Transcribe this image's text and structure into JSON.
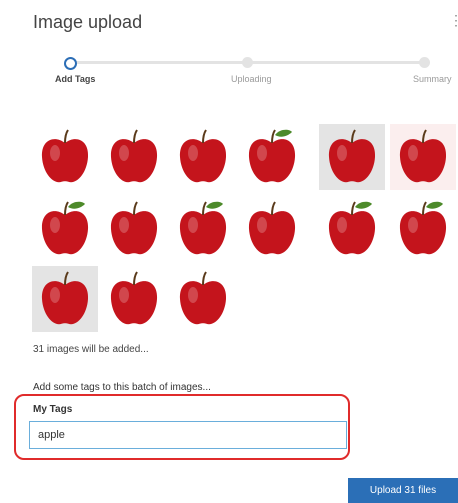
{
  "dialog": {
    "title": "Image upload"
  },
  "stepper": {
    "steps": [
      {
        "label": "Add Tags",
        "state": "active"
      },
      {
        "label": "Uploading",
        "state": "pending"
      },
      {
        "label": "Summary",
        "state": "pending"
      }
    ]
  },
  "images": {
    "count_text": "31 images will be added...",
    "thumbnails": [
      {
        "icon": "red-apple-image",
        "bg": "plain"
      },
      {
        "icon": "red-apple-image",
        "bg": "plain"
      },
      {
        "icon": "red-apple-image",
        "bg": "plain"
      },
      {
        "icon": "red-apple-with-leaf-image",
        "bg": "plain"
      },
      {
        "icon": "red-apple-image",
        "bg": "shaded"
      },
      {
        "icon": "red-apple-image",
        "bg": "pinkish"
      },
      {
        "icon": "red-apple-with-leaf-image",
        "bg": "plain"
      },
      {
        "icon": "red-apple-image",
        "bg": "plain"
      },
      {
        "icon": "red-apple-with-leaf-image",
        "bg": "plain"
      },
      {
        "icon": "red-apple-image",
        "bg": "plain"
      },
      {
        "icon": "red-apple-with-leaf-image",
        "bg": "plain"
      },
      {
        "icon": "red-apple-with-leaf-image",
        "bg": "plain"
      },
      {
        "icon": "red-apple-image",
        "bg": "shaded"
      },
      {
        "icon": "red-apple-image",
        "bg": "plain"
      },
      {
        "icon": "red-apple-image",
        "bg": "plain"
      }
    ]
  },
  "tags": {
    "prompt": "Add some tags to this batch of images...",
    "field_label": "My Tags",
    "value": "apple"
  },
  "actions": {
    "upload_label": "Upload 31 files"
  },
  "colors": {
    "accent": "#2b6fb7",
    "highlight": "#e02b2b",
    "apple_red": "#c4141c",
    "leaf_green": "#4d8a2a"
  }
}
